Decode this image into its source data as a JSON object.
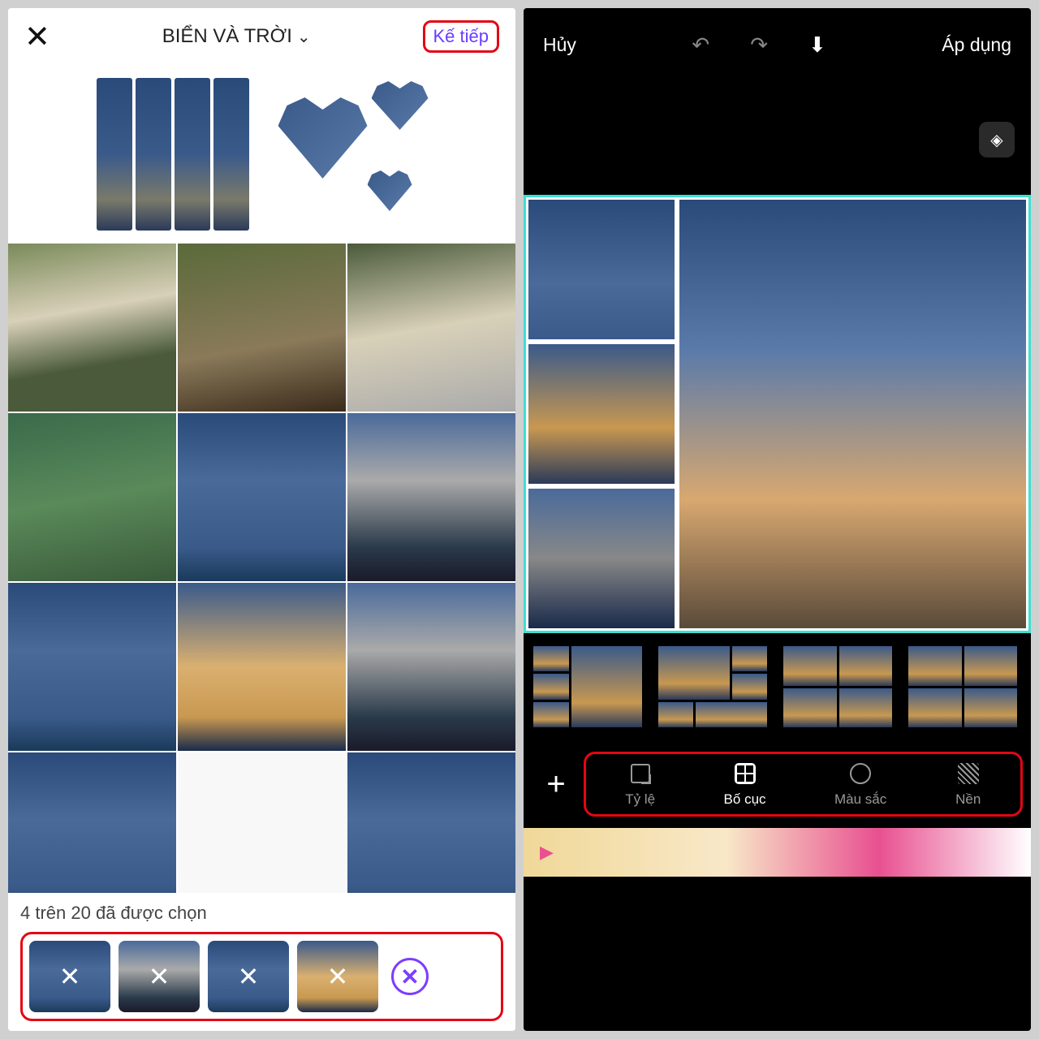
{
  "left": {
    "header": {
      "album_title": "BIỂN VÀ TRỜI",
      "next_label": "Kế tiếp"
    },
    "selection": {
      "status_text": "4 trên 20 đã được chọn",
      "selected_count": 4,
      "max_count": 20
    }
  },
  "right": {
    "header": {
      "cancel_label": "Hủy",
      "apply_label": "Áp dụng"
    },
    "nav": {
      "items": [
        {
          "key": "ratio",
          "label": "Tỷ lệ"
        },
        {
          "key": "layout",
          "label": "Bố cục"
        },
        {
          "key": "color",
          "label": "Màu sắc"
        },
        {
          "key": "background",
          "label": "Nền"
        }
      ],
      "active_key": "layout"
    }
  },
  "colors": {
    "highlight_red": "#e30613",
    "accent_purple": "#7b3eff",
    "selection_teal": "#3de0d0"
  }
}
